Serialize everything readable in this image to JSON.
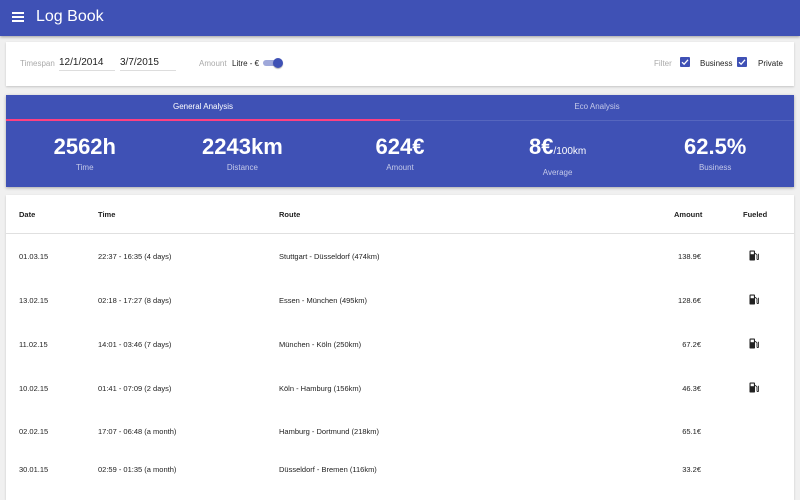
{
  "app": {
    "title": "Log Book",
    "menu_icon": "menu-icon",
    "brand_color": "#3f51b5",
    "accent_color": "#ff4081"
  },
  "filters": {
    "timespan_label": "Timespan",
    "date_from": "12/1/2014",
    "date_to": "3/7/2015",
    "amount_label": "Amount",
    "amount_unit": "Litre - €",
    "amount_toggle_on": true,
    "filter_label": "Filter",
    "business_label": "Business",
    "business_checked": true,
    "private_label": "Private",
    "private_checked": true
  },
  "tabs": [
    {
      "label": "General Analysis",
      "active": true
    },
    {
      "label": "Eco Analysis",
      "active": false
    }
  ],
  "stats": [
    {
      "value": "2562h",
      "suffix": "",
      "caption": "Time"
    },
    {
      "value": "2243km",
      "suffix": "",
      "caption": "Distance"
    },
    {
      "value": "624€",
      "suffix": "",
      "caption": "Amount"
    },
    {
      "value": "8€",
      "suffix": "/100km",
      "caption": "Average"
    },
    {
      "value": "62.5%",
      "suffix": "",
      "caption": "Business"
    }
  ],
  "table": {
    "columns": {
      "date": "Date",
      "time": "Time",
      "route": "Route",
      "amount": "Amount",
      "fueled": "Fueled"
    },
    "rows": [
      {
        "date": "01.03.15",
        "time": "22:37 - 16:35 (4 days)",
        "route": "Stuttgart - Düsseldorf (474km)",
        "amount": "138.9€",
        "fueled": true,
        "fuel_icon": "gas-station-icon"
      },
      {
        "date": "13.02.15",
        "time": "02:18 - 17:27 (8 days)",
        "route": "Essen - München (495km)",
        "amount": "128.6€",
        "fueled": true,
        "fuel_icon": "gas-station-icon"
      },
      {
        "date": "11.02.15",
        "time": "14:01 - 03:46 (7 days)",
        "route": "München - Köln (250km)",
        "amount": "67.2€",
        "fueled": true,
        "fuel_icon": "gas-station-icon"
      },
      {
        "date": "10.02.15",
        "time": "01:41 - 07:09 (2 days)",
        "route": "Köln - Hamburg (156km)",
        "amount": "46.3€",
        "fueled": true,
        "fuel_icon": "gas-station-icon"
      },
      {
        "date": "02.02.15",
        "time": "17:07 - 06:48 (a month)",
        "route": "Hamburg - Dortmund (218km)",
        "amount": "65.1€",
        "fueled": false,
        "fuel_icon": ""
      },
      {
        "date": "30.01.15",
        "time": "02:59 - 01:35 (a month)",
        "route": "Düsseldorf - Bremen (116km)",
        "amount": "33.2€",
        "fueled": false,
        "fuel_icon": ""
      }
    ]
  }
}
